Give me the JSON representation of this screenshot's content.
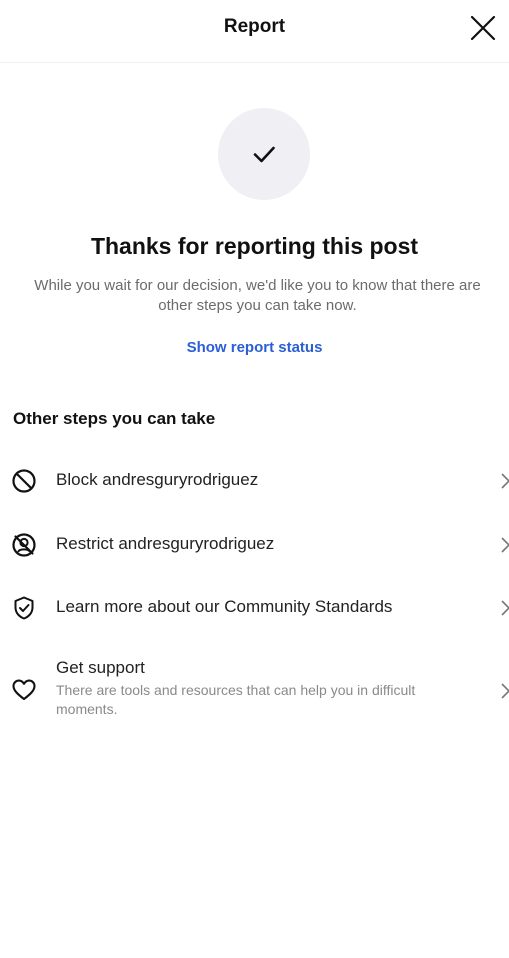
{
  "header": {
    "title": "Report",
    "close_icon": "close-icon"
  },
  "confirmation": {
    "icon": "checkmark-icon",
    "title": "Thanks for reporting this post",
    "description": "While you wait for our decision, we'd like you to know that there are other steps you can take now.",
    "status_link": "Show report status"
  },
  "steps": {
    "heading": "Other steps you can take",
    "items": [
      {
        "icon": "block-icon",
        "label": "Block andresguryrodriguez"
      },
      {
        "icon": "restrict-icon",
        "label": "Restrict andresguryrodriguez"
      },
      {
        "icon": "shield-check-icon",
        "label": "Learn more about our Community Standards"
      },
      {
        "icon": "heart-icon",
        "label": "Get support",
        "sublabel": "There are tools and resources that can help you in difficult moments."
      }
    ]
  },
  "colors": {
    "link": "#2b5fd6",
    "secondary_text": "#6b6b6b",
    "check_bg": "#efeff4"
  }
}
